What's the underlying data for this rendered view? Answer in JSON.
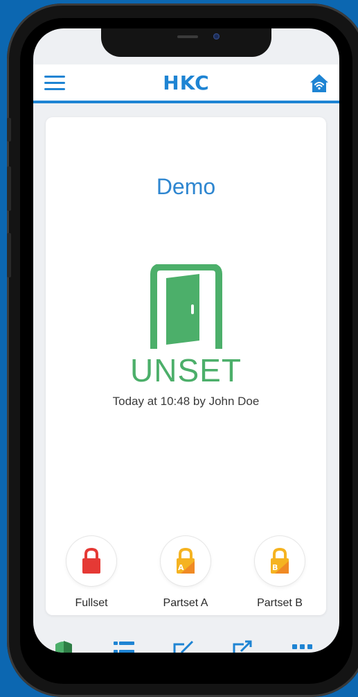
{
  "header": {
    "logo": "HKC",
    "menu_icon": "hamburger-menu-icon",
    "home_icon": "home-wifi-icon"
  },
  "panel": {
    "site_name": "Demo",
    "status": "UNSET",
    "status_detail": "Today at 10:48 by John Doe",
    "status_color": "#4caf6a"
  },
  "arm_buttons": [
    {
      "label": "Fullset",
      "icon": "lock-red-icon",
      "color": "#e53935"
    },
    {
      "label": "Partset A",
      "icon": "lock-partset-a-icon",
      "color": "#f5b321"
    },
    {
      "label": "Partset B",
      "icon": "lock-partset-b-icon",
      "color": "#f5b321"
    }
  ],
  "tabbar": {
    "items": [
      "shield-icon",
      "list-icon",
      "edit-icon",
      "share-icon",
      "more-icon"
    ]
  },
  "colors": {
    "background": "#0c67b1",
    "accent": "#1e84d3"
  }
}
